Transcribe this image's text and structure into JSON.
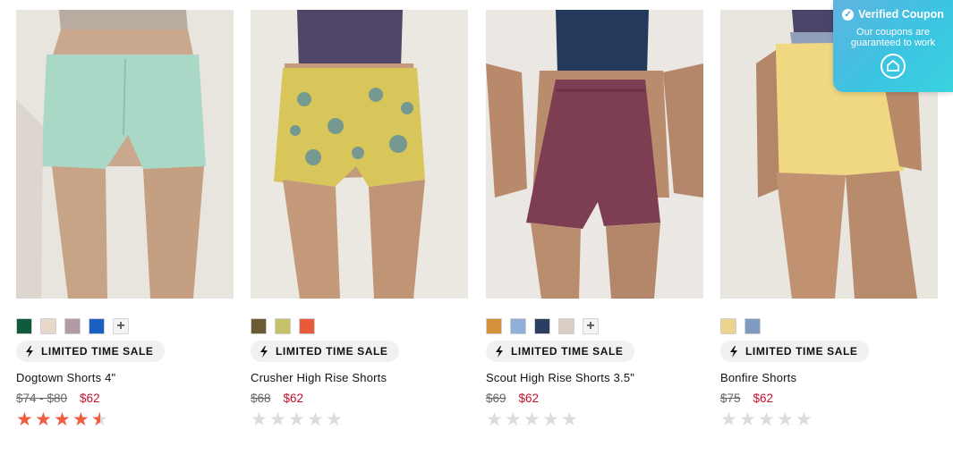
{
  "coupon": {
    "title": "Verified Coupon",
    "line1": "Our coupons are",
    "line2": "guaranteed to work",
    "icon": "check-circle-icon"
  },
  "products": [
    {
      "name": "Dogtown Shorts 4\"",
      "badge": "LIMITED TIME SALE",
      "original_price": "$74 - $80",
      "sale_price": "$62",
      "rating": 4.5,
      "swatches": [
        "#0f5b3c",
        "#e8d8c9",
        "#b49aa6",
        "#1b5fc1"
      ],
      "more_swatches": "+"
    },
    {
      "name": "Crusher High Rise Shorts",
      "badge": "LIMITED TIME SALE",
      "original_price": "$68",
      "sale_price": "$62",
      "rating": 0,
      "swatches": [
        "#6b5a33",
        "#c7c169",
        "#e85a3a"
      ],
      "more_swatches": ""
    },
    {
      "name": "Scout High Rise Shorts 3.5\"",
      "badge": "LIMITED TIME SALE",
      "original_price": "$69",
      "sale_price": "$62",
      "rating": 0,
      "swatches": [
        "#d4913c",
        "#8fb0d8",
        "#2a3e63",
        "#d9cfc2"
      ],
      "more_swatches": "+"
    },
    {
      "name": "Bonfire Shorts",
      "badge": "LIMITED TIME SALE",
      "original_price": "$75",
      "sale_price": "$62",
      "rating": 0,
      "swatches": [
        "#ecd390",
        "#7f9cc0"
      ],
      "more_swatches": ""
    }
  ]
}
